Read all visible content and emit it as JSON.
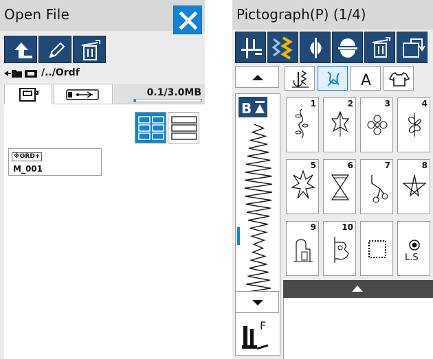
{
  "left": {
    "title": "Open File",
    "path": "/../Ordf",
    "capacity": "0.1/3.0MB",
    "capacity_fraction": 0.033,
    "file": {
      "tag": "※ORD+",
      "name": "M_001"
    },
    "icons": [
      "close-icon",
      "up-arrow-icon",
      "pencil-icon",
      "trash-icon",
      "folder-icon",
      "memory-icon",
      "usb-icon",
      "grid-view-icon",
      "list-view-icon"
    ]
  },
  "right": {
    "title": "Pictograph(P) (1/4)",
    "preview_label": "BĀ",
    "foot_letter": "F",
    "ls_label": "L.S",
    "numbers": [
      "1",
      "2",
      "3",
      "4",
      "5",
      "6",
      "7",
      "8",
      "9",
      "10"
    ],
    "cat_letter": "A",
    "colors": {
      "accent": "#0f84d6",
      "toolbar": "#1d4a78",
      "title": "#d8d8d8"
    }
  }
}
